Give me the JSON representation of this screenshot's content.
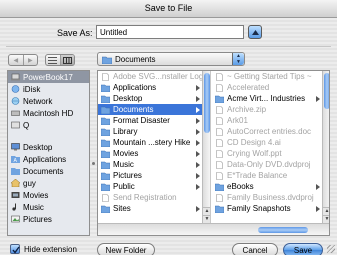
{
  "window": {
    "title": "Save to File"
  },
  "saveas": {
    "label": "Save As:",
    "value": "Untitled"
  },
  "location": {
    "label": "Documents"
  },
  "sidebar": {
    "devices": [
      {
        "label": "PowerBook17",
        "icon": "laptop-icon",
        "selected": true
      },
      {
        "label": "iDisk",
        "icon": "idisk-icon"
      },
      {
        "label": "Network",
        "icon": "network-icon"
      },
      {
        "label": "Macintosh HD",
        "icon": "hard-drive-icon"
      },
      {
        "label": "Q",
        "icon": "disk-icon"
      }
    ],
    "places": [
      {
        "label": "Desktop",
        "icon": "desktop-icon"
      },
      {
        "label": "Applications",
        "icon": "applications-icon"
      },
      {
        "label": "Documents",
        "icon": "documents-icon"
      },
      {
        "label": "guy",
        "icon": "home-icon"
      },
      {
        "label": "Movies",
        "icon": "movies-icon"
      },
      {
        "label": "Music",
        "icon": "music-icon"
      },
      {
        "label": "Pictures",
        "icon": "pictures-icon"
      }
    ]
  },
  "browser": {
    "col1": [
      {
        "label": "Adobe SVG...nstaller Log",
        "dim": true,
        "folder": false
      },
      {
        "label": "Applications",
        "folder": true
      },
      {
        "label": "Desktop",
        "folder": true
      },
      {
        "label": "Documents",
        "folder": true,
        "selected": true
      },
      {
        "label": "Format Disaster",
        "folder": true
      },
      {
        "label": "Library",
        "folder": true
      },
      {
        "label": "Mountain ...stery Hike",
        "folder": true
      },
      {
        "label": "Movies",
        "folder": true
      },
      {
        "label": "Music",
        "folder": true
      },
      {
        "label": "Pictures",
        "folder": true
      },
      {
        "label": "Public",
        "folder": true
      },
      {
        "label": "Send Registration",
        "dim": true,
        "folder": false
      },
      {
        "label": "Sites",
        "folder": true
      }
    ],
    "col2": [
      {
        "label": "~ Getting Started Tips ~",
        "dim": true,
        "folder": false
      },
      {
        "label": "Accelerated",
        "dim": true,
        "folder": false
      },
      {
        "label": "Acme Virt... Industries",
        "folder": true
      },
      {
        "label": "Archive.zip",
        "dim": true,
        "folder": false
      },
      {
        "label": "Ark01",
        "dim": true,
        "folder": false
      },
      {
        "label": "AutoCorrect entries.doc",
        "dim": true,
        "folder": false
      },
      {
        "label": "CD Design 4.ai",
        "dim": true,
        "folder": false
      },
      {
        "label": "Crying Wolf.ppt",
        "dim": true,
        "folder": false
      },
      {
        "label": "Data-Only DVD.dvdproj",
        "dim": true,
        "folder": false
      },
      {
        "label": "E*Trade Balance",
        "dim": true,
        "folder": false
      },
      {
        "label": "eBooks",
        "folder": true
      },
      {
        "label": "Family Business.dvdproj",
        "dim": true,
        "folder": false
      },
      {
        "label": "Family Snapshots",
        "folder": true
      }
    ]
  },
  "options": {
    "hide_extension_label": "Hide extension",
    "hide_extension_checked": true
  },
  "buttons": {
    "new_folder": "New Folder",
    "cancel": "Cancel",
    "save": "Save"
  },
  "colors": {
    "selection": "#3b75d9",
    "sidebar_selection": "#8f96a3",
    "aqua_blue": "#5a9be6"
  }
}
